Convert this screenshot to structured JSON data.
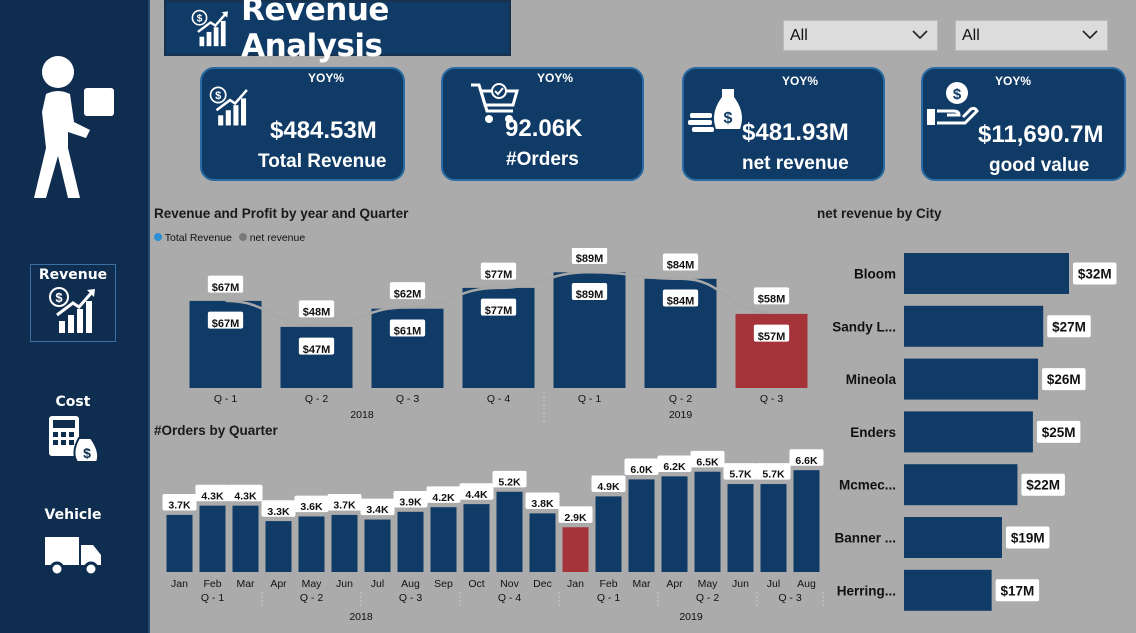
{
  "sidebar": {
    "items": [
      {
        "label": "Revenue",
        "icon": "revenue-growth-icon",
        "active": true
      },
      {
        "label": "Cost",
        "icon": "cost-calculator-icon",
        "active": false
      },
      {
        "label": "Vehicle",
        "icon": "truck-icon",
        "active": false
      }
    ]
  },
  "header": {
    "title": "Revenue Analysis"
  },
  "filters": [
    {
      "value": "All"
    },
    {
      "value": "All"
    }
  ],
  "kpis": [
    {
      "yoy": "YOY%",
      "value": "$484.53M",
      "label": "Total Revenue",
      "icon": "revenue-growth-icon"
    },
    {
      "yoy": "YOY%",
      "value": "92.06K",
      "label": "#Orders",
      "icon": "shopping-cart-icon"
    },
    {
      "yoy": "YOY%",
      "value": "$481.93M",
      "label": "net revenue",
      "icon": "money-bag-icon"
    },
    {
      "yoy": "YOY%",
      "value": "$11,690.7M",
      "label": "good value",
      "icon": "dollar-hand-icon"
    }
  ],
  "colors": {
    "navy": "#0f3b66",
    "highlight": "#a4343a",
    "line": "#a8a8a8",
    "legend_total": "#2b8fd6",
    "legend_net": "#7a7a7a"
  },
  "chart_data": [
    {
      "type": "bar",
      "title": "Revenue and Profit by year and Quarter",
      "legend": [
        "Total Revenue",
        "net revenue"
      ],
      "categories": [
        "Q - 1",
        "Q - 2",
        "Q - 3",
        "Q - 4",
        "Q - 1",
        "Q - 2",
        "Q - 3"
      ],
      "groups": [
        {
          "label": "2018",
          "count": 4
        },
        {
          "label": "2019",
          "count": 3
        }
      ],
      "series": [
        {
          "name": "Total Revenue",
          "type": "bar",
          "values": [
            67,
            47,
            61,
            77,
            89,
            84,
            57
          ],
          "labels": [
            "$67M",
            "$47M",
            "$61M",
            "$77M",
            "$89M",
            "$84M",
            "$57M"
          ]
        },
        {
          "name": "net revenue",
          "type": "line",
          "values": [
            67,
            48,
            62,
            77,
            89,
            84,
            58
          ],
          "labels": [
            "$67M",
            "$48M",
            "$62M",
            "$77M",
            "$89M",
            "$84M",
            "$58M"
          ]
        }
      ],
      "highlight_index": 6,
      "ylim": [
        0,
        100
      ]
    },
    {
      "type": "bar",
      "title": "#Orders by Quarter",
      "categories": [
        "Jan",
        "Feb",
        "Mar",
        "Apr",
        "May",
        "Jun",
        "Jul",
        "Aug",
        "Sep",
        "Oct",
        "Nov",
        "Dec",
        "Jan",
        "Feb",
        "Mar",
        "Apr",
        "May",
        "Jun",
        "Jul",
        "Aug"
      ],
      "values": [
        3.7,
        4.3,
        4.3,
        3.3,
        3.6,
        3.7,
        3.4,
        3.9,
        4.2,
        4.4,
        5.2,
        3.8,
        2.9,
        4.9,
        6.0,
        6.2,
        6.5,
        5.7,
        5.7,
        6.6
      ],
      "labels": [
        "3.7K",
        "4.3K",
        "4.3K",
        "3.3K",
        "3.6K",
        "3.7K",
        "3.4K",
        "3.9K",
        "4.2K",
        "4.4K",
        "5.2K",
        "3.8K",
        "2.9K",
        "4.9K",
        "6.0K",
        "6.2K",
        "6.5K",
        "5.7K",
        "5.7K",
        "6.6K"
      ],
      "quarters": [
        {
          "label": "Q - 1",
          "count": 3
        },
        {
          "label": "Q - 2",
          "count": 3
        },
        {
          "label": "Q - 3",
          "count": 3
        },
        {
          "label": "Q - 4",
          "count": 3
        },
        {
          "label": "Q - 1",
          "count": 3
        },
        {
          "label": "Q - 2",
          "count": 3
        },
        {
          "label": "Q - 3",
          "count": 2
        }
      ],
      "years": [
        {
          "label": "2018",
          "count": 12
        },
        {
          "label": "2019",
          "count": 8
        }
      ],
      "highlight_index": 12,
      "ylim": [
        0,
        7
      ]
    },
    {
      "type": "bar",
      "orientation": "horizontal",
      "title": "net revenue by City",
      "categories": [
        "Bloom",
        "Sandy L...",
        "Mineola",
        "Enders",
        "Mcmec...",
        "Banner ...",
        "Herring..."
      ],
      "values": [
        32,
        27,
        26,
        25,
        22,
        19,
        17
      ],
      "labels": [
        "$32M",
        "$27M",
        "$26M",
        "$25M",
        "$22M",
        "$19M",
        "$17M"
      ],
      "xlim": [
        0,
        32
      ]
    }
  ]
}
